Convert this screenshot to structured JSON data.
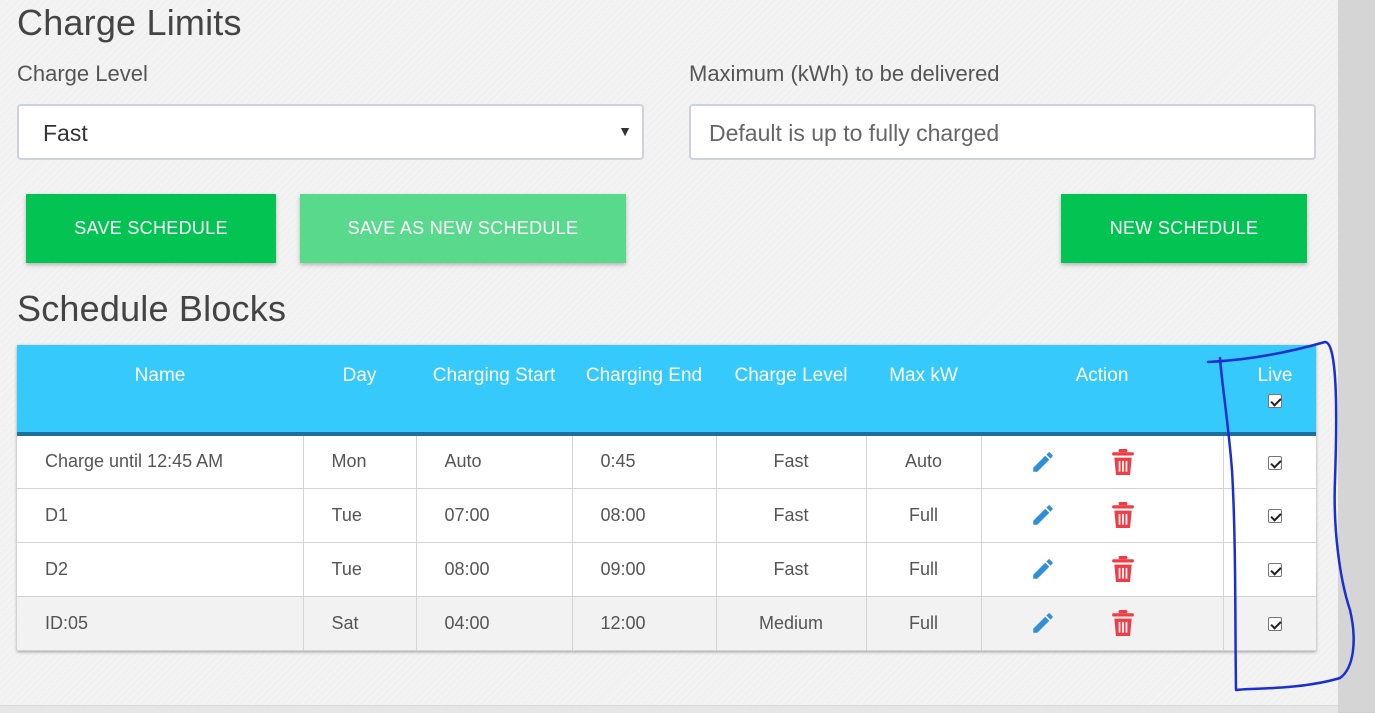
{
  "section_title": "Charge Limits",
  "charge_level": {
    "label": "Charge Level",
    "value": "Fast"
  },
  "max_kwh": {
    "label": "Maximum (kWh) to be delivered",
    "placeholder": "Default is up to fully charged"
  },
  "buttons": {
    "save": "SAVE SCHEDULE",
    "save_as_new": "SAVE AS NEW SCHEDULE",
    "new": "NEW SCHEDULE"
  },
  "blocks_title": "Schedule Blocks",
  "table": {
    "headers": [
      "Name",
      "Day",
      "Charging Start",
      "Charging End",
      "Charge Level",
      "Max kW",
      "Action",
      "Live"
    ],
    "header_live_checked": true,
    "rows": [
      {
        "name": "Charge until 12:45 AM",
        "day": "Mon",
        "start": "Auto",
        "end": "0:45",
        "level": "Fast",
        "max": "Auto",
        "live": true
      },
      {
        "name": "D1",
        "day": "Tue",
        "start": "07:00",
        "end": "08:00",
        "level": "Fast",
        "max": "Full",
        "live": true
      },
      {
        "name": "D2",
        "day": "Tue",
        "start": "08:00",
        "end": "09:00",
        "level": "Fast",
        "max": "Full",
        "live": true
      },
      {
        "name": "ID:05",
        "day": "Sat",
        "start": "04:00",
        "end": "12:00",
        "level": "Medium",
        "max": "Full",
        "live": true
      }
    ]
  },
  "icons": {
    "edit": "pencil-icon",
    "delete": "trash-icon"
  },
  "colors": {
    "primary_green": "#03c452",
    "disabled_green": "#58d98b",
    "header_blue": "#36c9fb",
    "edit_blue": "#2f8fd8",
    "delete_red": "#f23c45",
    "annotation_blue": "#1a2fd0"
  }
}
